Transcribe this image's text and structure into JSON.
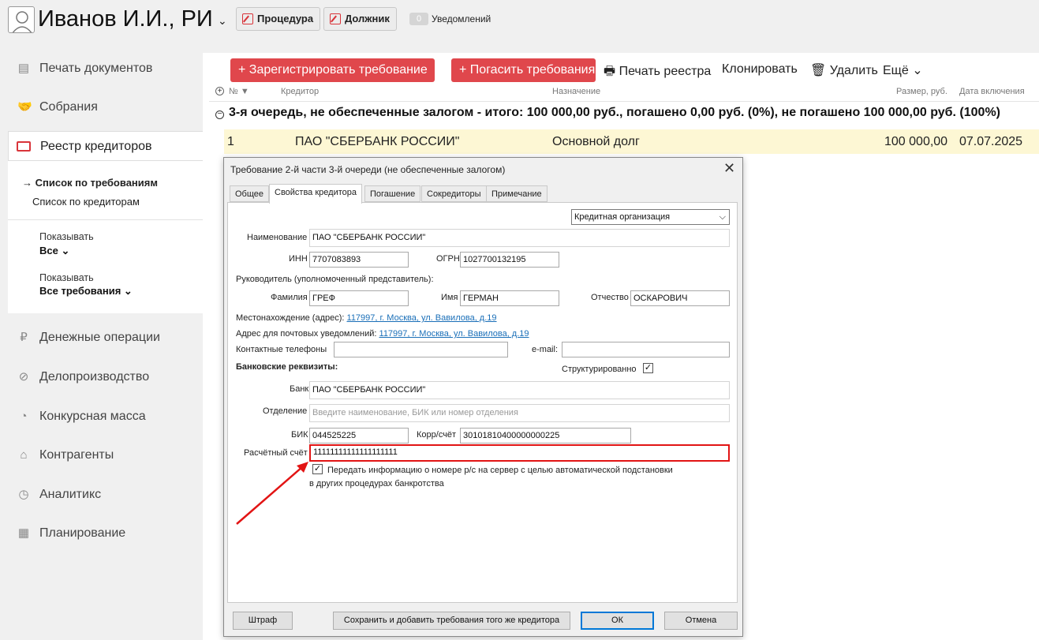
{
  "header": {
    "username": "Иванов И.И., РИ",
    "procedure_btn": "Процедура",
    "debtor_btn": "Должник",
    "notif_count": "0",
    "notif_label": "Уведомлений"
  },
  "sidebar": {
    "items": [
      {
        "label": "Печать документов",
        "icon": "document-icon"
      },
      {
        "label": "Собрания",
        "icon": "handshake-icon"
      },
      {
        "label": "Реестр кредиторов",
        "icon": "id-card-icon"
      },
      {
        "label": "Денежные операции",
        "icon": "ruble-icon"
      },
      {
        "label": "Делопроизводство",
        "icon": "paperclip-icon"
      },
      {
        "label": "Конкурсная масса",
        "icon": "piggy-bank-icon"
      },
      {
        "label": "Контрагенты",
        "icon": "bank-icon"
      },
      {
        "label": "Аналитикс",
        "icon": "chart-icon"
      },
      {
        "label": "Планирование",
        "icon": "calendar-icon"
      }
    ],
    "sub": {
      "active": "→ Список по требованиям",
      "second": "Список по кредиторам",
      "filter1_label": "Показывать",
      "filter1_value": "Все",
      "filter2_label": "Показывать",
      "filter2_value": "Все требования"
    }
  },
  "toolbar": {
    "register": "+ Зарегистрировать требование",
    "repay": "+ Погасить требования",
    "print": "Печать реестра",
    "clone": "Клонировать",
    "delete": "Удалить",
    "more": "Ещё"
  },
  "table": {
    "headers": {
      "num": "№",
      "creditor": "Кредитор",
      "purpose": "Назначение",
      "amount": "Размер, руб.",
      "date": "Дата включения"
    },
    "group": "3-я очередь, не обеспеченные залогом - итого: 100 000,00 руб., погашено 0,00 руб. (0%), не погашено 100 000,00 руб. (100%)",
    "rows": [
      {
        "num": "1",
        "creditor": "ПАО \"СБЕРБАНК РОССИИ\"",
        "purpose": "Основной долг",
        "amount": "100 000,00",
        "date": "07.07.2025"
      }
    ]
  },
  "dialog": {
    "title": "Требование 2-й части 3-й очереди (не обеспеченные залогом)",
    "tabs": [
      "Общее",
      "Свойства кредитора",
      "Погашение",
      "Сокредиторы",
      "Примечание"
    ],
    "type_select": "Кредитная организация",
    "labels": {
      "name": "Наименование",
      "inn": "ИНН",
      "ogrn": "ОГРН",
      "head": "Руководитель (уполномоченный представитель):",
      "surname": "Фамилия",
      "firstname": "Имя",
      "patronymic": "Отчество",
      "address": "Местонахождение (адрес):",
      "postal": "Адрес для почтовых уведомлений:",
      "phones": "Контактные телефоны",
      "email": "e-mail:",
      "bank_details": "Банковские реквизиты:",
      "structured": "Структурированно",
      "bank": "Банк",
      "branch": "Отделение",
      "bik": "БИК",
      "corr": "Корр/счёт",
      "account": "Расчётный счёт",
      "transfer_1": "Передать информацию о номере р/с на сервер с целью автоматической подстановки",
      "transfer_2": "в других процедурах банкротства"
    },
    "values": {
      "name": "ПАО \"СБЕРБАНК РОССИИ\"",
      "inn": "7707083893",
      "ogrn": "1027700132195",
      "surname": "ГРЕФ",
      "firstname": "ГЕРМАН",
      "patronymic": "ОСКАРОВИЧ",
      "address": "117997, г. Москва, ул. Вавилова, д.19",
      "postal": "117997, г. Москва, ул. Вавилова, д.19",
      "phones": "",
      "email": "",
      "bank": "ПАО \"СБЕРБАНК РОССИИ\"",
      "branch_placeholder": "Введите наименование, БИК или номер отделения",
      "bik": "044525225",
      "corr": "30101810400000000225",
      "account": "11111111111111111111"
    },
    "buttons": {
      "fine": "Штраф",
      "save_add": "Сохранить и добавить требования того же кредитора",
      "ok": "ОК",
      "cancel": "Отмена"
    }
  },
  "colors": {
    "accent": "#e0474c",
    "highlight": "#e21414",
    "row_bg": "#fdf7d4",
    "link": "#1a6fb8"
  }
}
